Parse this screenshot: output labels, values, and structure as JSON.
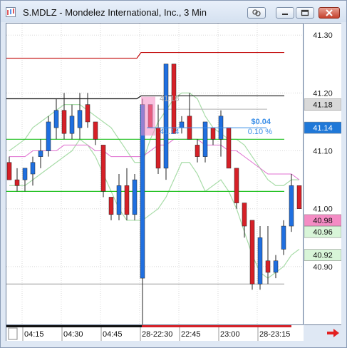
{
  "window": {
    "title": "S.MDLZ - Mondelez International, Inc., 3 Min"
  },
  "icons": {
    "app": "chart-app-icon",
    "link": "link-chain-icon",
    "minimize": "minimize-icon",
    "maximize": "maximize-icon",
    "close": "close-icon",
    "next": "scroll-right-arrow-icon"
  },
  "colors": {
    "up_candle": "#1f6fe0",
    "down_candle": "#d62027",
    "upper_band": "#c00000",
    "resistance": "#111111",
    "green_line": "#20c020",
    "pink_ma": "#e070d0",
    "band": "#a8dca8",
    "bid_tag": "#f48cc4",
    "last_tag": "#1f78d8",
    "grey_tag": "#d9d9d9",
    "green_tag": "#d8f5d8",
    "measure": "#3b8fe8"
  },
  "chart_data": {
    "type": "candlestick",
    "title": "S.MDLZ - Mondelez International, Inc., 3 Min",
    "y_ticks": [
      "41.30",
      "41.20",
      "41.10",
      "41.00",
      "40.90"
    ],
    "ylim": [
      40.8,
      41.32
    ],
    "x_ticks": [
      "04:15",
      "04:30",
      "04:45",
      "28-22:30",
      "22:45",
      "23:00",
      "28-23:15"
    ],
    "x_tick_index": [
      2,
      7,
      12,
      17,
      22,
      27,
      32
    ],
    "candles": [
      {
        "o": 41.08,
        "h": 41.09,
        "l": 41.05,
        "c": 41.05
      },
      {
        "o": 41.05,
        "h": 41.07,
        "l": 41.03,
        "c": 41.04
      },
      {
        "o": 41.05,
        "h": 41.07,
        "l": 41.03,
        "c": 41.07
      },
      {
        "o": 41.06,
        "h": 41.09,
        "l": 41.04,
        "c": 41.08
      },
      {
        "o": 41.09,
        "h": 41.12,
        "l": 41.07,
        "c": 41.1
      },
      {
        "o": 41.1,
        "h": 41.16,
        "l": 41.09,
        "c": 41.15
      },
      {
        "o": 41.14,
        "h": 41.19,
        "l": 41.12,
        "c": 41.17
      },
      {
        "o": 41.17,
        "h": 41.2,
        "l": 41.12,
        "c": 41.13
      },
      {
        "o": 41.13,
        "h": 41.18,
        "l": 41.12,
        "c": 41.16
      },
      {
        "o": 41.14,
        "h": 41.2,
        "l": 41.12,
        "c": 41.17
      },
      {
        "o": 41.18,
        "h": 41.2,
        "l": 41.14,
        "c": 41.15
      },
      {
        "o": 41.15,
        "h": 41.15,
        "l": 41.11,
        "c": 41.12
      },
      {
        "o": 41.11,
        "h": 41.11,
        "l": 41.02,
        "c": 41.03
      },
      {
        "o": 41.02,
        "h": 41.02,
        "l": 40.98,
        "c": 40.99
      },
      {
        "o": 40.99,
        "h": 41.06,
        "l": 40.98,
        "c": 41.04
      },
      {
        "o": 41.04,
        "h": 41.07,
        "l": 40.98,
        "c": 40.99
      },
      {
        "o": 40.99,
        "h": 41.06,
        "l": 40.98,
        "c": 41.05
      },
      {
        "o": 40.88,
        "h": 41.19,
        "l": 40.75,
        "c": 41.18
      },
      {
        "o": 41.18,
        "h": 41.18,
        "l": 41.14,
        "c": 41.14
      },
      {
        "o": 41.14,
        "h": 41.18,
        "l": 41.06,
        "c": 41.07
      },
      {
        "o": 41.07,
        "h": 41.25,
        "l": 41.05,
        "c": 41.25
      },
      {
        "o": 41.25,
        "h": 41.25,
        "l": 41.13,
        "c": 41.13
      },
      {
        "o": 41.14,
        "h": 41.16,
        "l": 41.13,
        "c": 41.15
      },
      {
        "o": 41.16,
        "h": 41.2,
        "l": 41.12,
        "c": 41.12
      },
      {
        "o": 41.11,
        "h": 41.12,
        "l": 41.08,
        "c": 41.09
      },
      {
        "o": 41.09,
        "h": 41.15,
        "l": 41.08,
        "c": 41.15
      },
      {
        "o": 41.14,
        "h": 41.14,
        "l": 41.11,
        "c": 41.12
      },
      {
        "o": 41.12,
        "h": 41.17,
        "l": 41.09,
        "c": 41.16
      },
      {
        "o": 41.14,
        "h": 41.14,
        "l": 41.07,
        "c": 41.07
      },
      {
        "o": 41.07,
        "h": 41.07,
        "l": 41.0,
        "c": 41.01
      },
      {
        "o": 41.01,
        "h": 41.01,
        "l": 40.95,
        "c": 40.97
      },
      {
        "o": 40.98,
        "h": 40.98,
        "l": 40.86,
        "c": 40.87
      },
      {
        "o": 40.87,
        "h": 40.97,
        "l": 40.86,
        "c": 40.95
      },
      {
        "o": 40.91,
        "h": 40.97,
        "l": 40.87,
        "c": 40.89
      },
      {
        "o": 40.89,
        "h": 40.92,
        "l": 40.88,
        "c": 40.91
      },
      {
        "o": 40.93,
        "h": 40.98,
        "l": 40.92,
        "c": 40.97
      },
      {
        "o": 40.97,
        "h": 41.06,
        "l": 40.96,
        "c": 41.04
      },
      {
        "o": 41.04,
        "h": 41.04,
        "l": 41.0,
        "c": 41.0
      }
    ],
    "lines": {
      "upper_red": {
        "from": 41.26,
        "to": 41.27,
        "step_at": 17
      },
      "resistance_black": {
        "from": 41.19,
        "to": 41.195,
        "step_at": 17
      },
      "green_mid": 41.12,
      "green_low": 41.03,
      "grey_low": 40.87,
      "grey_dash": 41.172
    },
    "bands": {
      "upper": [
        41.1,
        41.11,
        41.12,
        41.14,
        41.15,
        41.16,
        41.17,
        41.18,
        41.18,
        41.18,
        41.17,
        41.16,
        41.15,
        41.14,
        41.12,
        41.1,
        41.08,
        41.08,
        41.12,
        41.15,
        41.17,
        41.19,
        41.2,
        41.2,
        41.19,
        41.16,
        41.14,
        41.13,
        41.12,
        41.12,
        41.11,
        41.09,
        41.07,
        41.05,
        41.04,
        41.04,
        41.05,
        41.05
      ],
      "lower": [
        41.04,
        41.04,
        41.04,
        41.05,
        41.06,
        41.07,
        41.08,
        41.09,
        41.1,
        41.12,
        41.11,
        41.09,
        41.06,
        41.03,
        41.0,
        40.98,
        40.98,
        40.98,
        40.99,
        41.0,
        41.02,
        41.05,
        41.08,
        41.08,
        41.06,
        41.03,
        41.04,
        41.05,
        41.03,
        41.0,
        40.96,
        40.92,
        40.89,
        40.88,
        40.89,
        40.9,
        40.92,
        40.93
      ],
      "ma": [
        41.09,
        41.09,
        41.09,
        41.1,
        41.1,
        41.1,
        41.1,
        41.11,
        41.11,
        41.11,
        41.11,
        41.1,
        41.1,
        41.09,
        41.09,
        41.09,
        41.09,
        41.09,
        41.1,
        41.11,
        41.11,
        41.12,
        41.12,
        41.12,
        41.12,
        41.11,
        41.11,
        41.11,
        41.1,
        41.1,
        41.09,
        41.08,
        41.07,
        41.06,
        41.06,
        41.06,
        41.06,
        41.05
      ]
    },
    "price_tags": [
      {
        "value": 41.18,
        "label": "41.18",
        "style": "grey"
      },
      {
        "value": 41.14,
        "label": "41.14",
        "style": "last"
      },
      {
        "value": 40.98,
        "label": "40.98",
        "style": "bid"
      },
      {
        "value": 40.96,
        "label": "40.96",
        "style": "green"
      },
      {
        "value": 40.92,
        "label": "40.92",
        "style": "green"
      }
    ],
    "measure": {
      "change": "$0.04",
      "percent": "0.10 %",
      "start_label": "41.18",
      "end_label": "41.14",
      "start": 41.18,
      "end": 41.14,
      "from_index": 17,
      "to_index": 21
    }
  }
}
